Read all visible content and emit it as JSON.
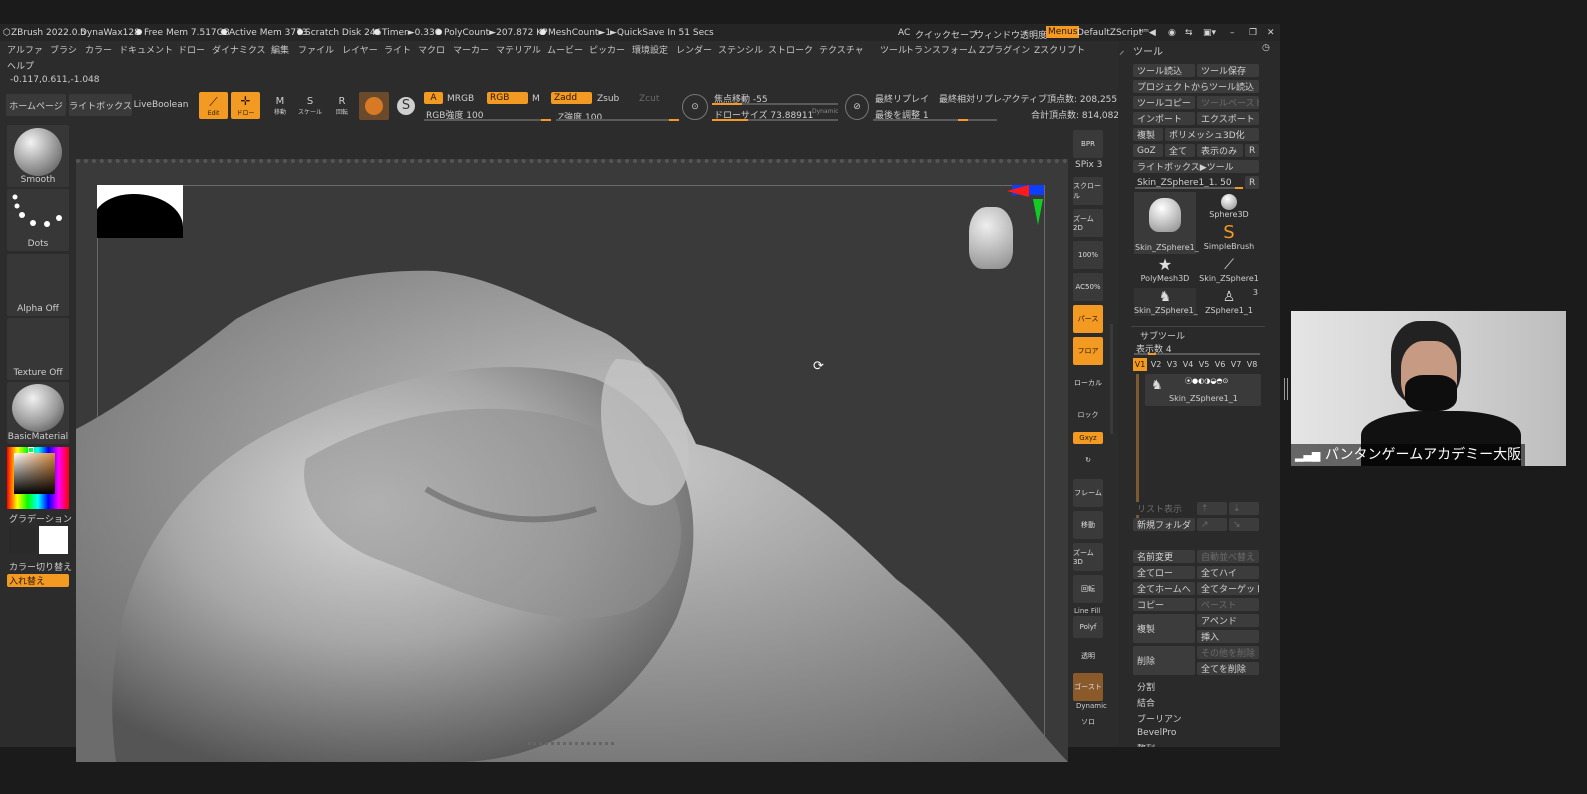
{
  "titlebar": {
    "app": "ZBrush 2022.0.5",
    "brush": "DynaWax128",
    "free_mem": "Free Mem 7.517GB",
    "active_mem": "Active Mem 3773",
    "scratch": "Scratch Disk 246",
    "timer": "Timer►0.336",
    "polycount": "PolyCount►207.872 KP",
    "meshcount": "MeshCount►1",
    "quicksave": "►QuickSave In 51 Secs",
    "ac": "AC",
    "quicksave_btn": "クイックセーブ",
    "window_transparency": "ウィンドウ透明度",
    "menus": "Menus",
    "default_zscript": "DefaultZScript"
  },
  "menubar": [
    "アルファ",
    "ブラシ",
    "カラー",
    "ドキュメント",
    "ドロー",
    "ダイナミクス",
    "編集",
    "ファイル",
    "レイヤー",
    "ライト",
    "マクロ",
    "マーカー",
    "マテリアル",
    "ムービー",
    "ピッカー",
    "環境設定",
    "レンダー",
    "ステンシル",
    "ストローク",
    "テクスチャ",
    "ツール",
    "トランスフォーム",
    "Zプラグイン",
    "Zスクリプト"
  ],
  "help": "ヘルプ",
  "coords": "-0.117,0.611,-1.048",
  "toolbar": {
    "home": "ホームページ",
    "lightbox": "ライトボックス",
    "liveboolean": "LiveBoolean",
    "edit": "Edit",
    "draw": "ドロー",
    "move": "移動",
    "scale": "スケール",
    "rotate": "回転",
    "a": "A",
    "mrgb": "MRGB",
    "rgb": "RGB",
    "m": "M",
    "rgb_intensity": "RGB強度 100",
    "zadd": "Zadd",
    "zsub": "Zsub",
    "zcut": "Zcut",
    "z_intensity": "Z強度 100",
    "focal_shift": "焦点移動 -55",
    "draw_size": "ドローサイズ 73.88911",
    "dynamic": "Dynamic",
    "last_replay": "最終リプレイ",
    "last_rel_replay": "最終相対リプレ-",
    "adjust_last": "最後を調整 1",
    "active_points": "アクティブ頂点数: 208,255",
    "total_points": "合計頂点数: 814,082"
  },
  "left": {
    "brush": "Smooth",
    "stroke": "Dots",
    "alpha": "Alpha Off",
    "texture": "Texture Off",
    "material": "BasicMaterial",
    "gradient": "グラデーション",
    "color_switch": "カラー切り替え",
    "swap": "入れ替え"
  },
  "rightbar": {
    "bpr": "BPR",
    "spix": "SPix 3",
    "scroll": "スクロール",
    "zoom2d": "ズーム2D",
    "hundred": "100%",
    "ac50": "AC50%",
    "persp": "パース",
    "floor": "フロア",
    "local": "ローカル",
    "lock": "ロック",
    "xyz": "Gxyz",
    "frame": "フレーム",
    "move": "移動",
    "zoom3d": "ズーム3D",
    "rotate": "回転",
    "linefill": "Line Fill",
    "polyf": "Polyf",
    "transp": "透明",
    "ghost": "ゴースト",
    "dynamic": "Dynamic",
    "solo": "ソロ"
  },
  "tool_panel": {
    "title": "ツール",
    "load": "ツール読込",
    "save": "ツール保存",
    "load_project": "プロジェクトからツール読込",
    "copy": "ツールコピー",
    "paste": "ツールペースト",
    "import": "インポート",
    "export": "エクスポート",
    "clone": "複製",
    "make_polymesh": "ポリメッシュ3D化",
    "goz": "GoZ",
    "all": "全て",
    "visible": "表示のみ",
    "r": "R",
    "lightbox_tool": "ライトボックス▶ツール",
    "current": "Skin_ZSphere1_1. 50",
    "thumbs": [
      "Skin_ZSphere1_",
      "Sphere3D",
      "Skin_ZSphere1_",
      "SimpleBrush",
      "PolyMesh3D",
      "Skin_ZSphere1",
      "Skin_ZSphere1_",
      "ZSphere1_1"
    ],
    "thumb_count": "3"
  },
  "subtool": {
    "title": "サブツール",
    "visible_count": "表示数 4",
    "versions": [
      "V1",
      "V2",
      "V3",
      "V4",
      "V5",
      "V6",
      "V7",
      "V8"
    ],
    "item": "Skin_ZSphere1_1",
    "list_all": "リスト表示",
    "new_folder": "新規フォルダ",
    "rename": "名前変更",
    "auto_reorder": "自動並べ替え",
    "all_low": "全てロー",
    "all_high": "全てハイ",
    "all_home": "全てホームへ",
    "all_target": "全てターゲット",
    "copy": "コピー",
    "paste": "ペースト",
    "duplicate": "複製",
    "append": "アペンド",
    "insert": "挿入",
    "delete": "削除",
    "delete_other": "その他を削除",
    "delete_all": "全てを削除",
    "split": "分割",
    "merge": "結合",
    "boolean": "ブーリアン",
    "bevelpro": "BevelPro",
    "remesh": "整列"
  },
  "webcam": {
    "name": "パンタンゲームアカデミー大阪"
  },
  "colors": {
    "accent": "#f29a21",
    "bg": "#2c2c2c"
  }
}
